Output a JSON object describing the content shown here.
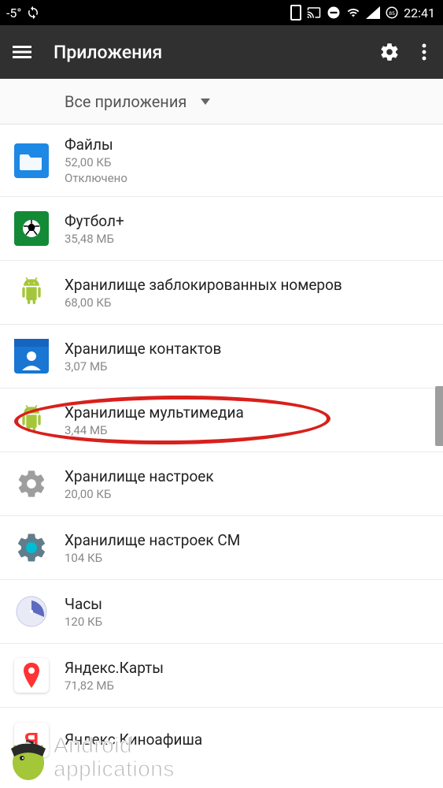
{
  "status": {
    "temp": "-5°",
    "time": "22:41",
    "battery_pct": "85"
  },
  "header": {
    "title": "Приложения"
  },
  "filter": {
    "label": "Все приложения"
  },
  "apps": [
    {
      "name": "Файлы",
      "size": "52,00 КБ",
      "status": "Отключено",
      "icon": "files"
    },
    {
      "name": "Футбол+",
      "size": "35,48 МБ",
      "icon": "football"
    },
    {
      "name": "Хранилище заблокированных номеров",
      "size": "68,00 КБ",
      "icon": "android"
    },
    {
      "name": "Хранилище контактов",
      "size": "3,07 МБ",
      "icon": "contacts"
    },
    {
      "name": "Хранилище мультимедиа",
      "size": "3,44 МБ",
      "icon": "android"
    },
    {
      "name": "Хранилище настроек",
      "size": "20,00 КБ",
      "icon": "settings"
    },
    {
      "name": "Хранилище настроек CM",
      "size": "104 КБ",
      "icon": "settings-cm"
    },
    {
      "name": "Часы",
      "size": "120 КБ",
      "icon": "clock"
    },
    {
      "name": "Яндекс.Карты",
      "size": "71,82 МБ",
      "icon": "yandex"
    },
    {
      "name": "Яндекс.Киноафиша",
      "size": "",
      "icon": "yandex"
    }
  ],
  "watermark": {
    "line1": "Android",
    "line2": "applications"
  }
}
